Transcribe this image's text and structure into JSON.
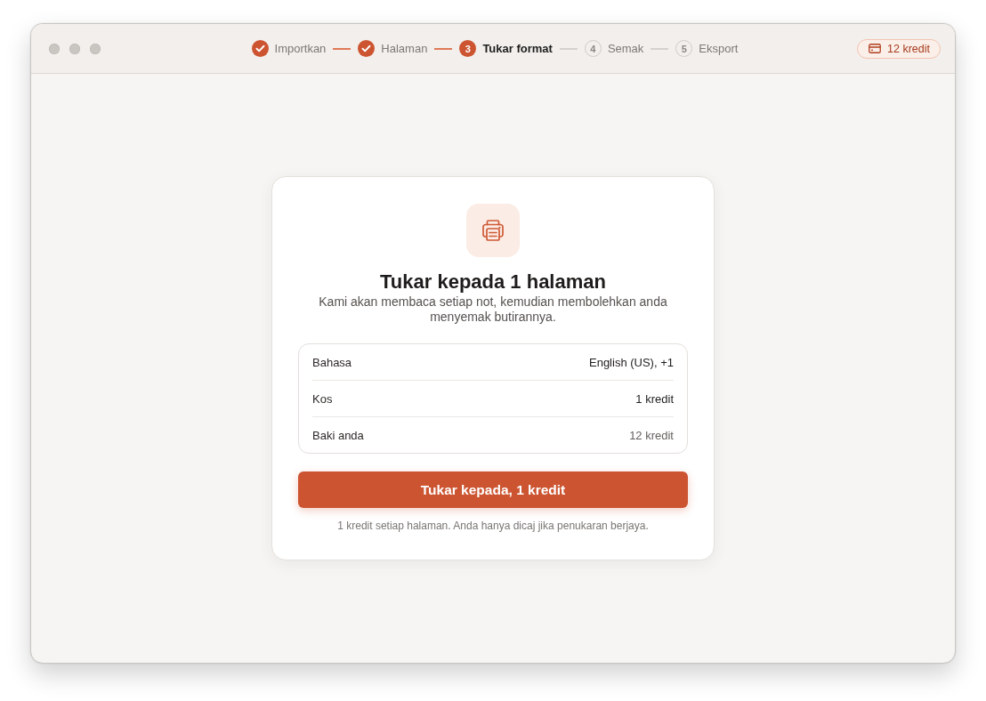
{
  "stepper": {
    "steps": [
      {
        "label": "Importkan",
        "done": true,
        "selected": false
      },
      {
        "label": "Halaman",
        "done": true,
        "selected": false
      },
      {
        "label": "Tukar format",
        "number": "3",
        "done": false,
        "selected": true
      },
      {
        "label": "Semak",
        "number": "4",
        "done": false,
        "selected": false
      },
      {
        "label": "Eksport",
        "number": "5",
        "done": false,
        "selected": false
      }
    ]
  },
  "credits_badge": {
    "label": "12 kredit"
  },
  "dialog": {
    "title": "Tukar kepada 1 halaman",
    "description": "Kami akan membaca setiap not, kemudian membolehkan anda menyemak butirannya.",
    "details": [
      {
        "label": "Bahasa",
        "value": "English (US), +1",
        "muted": false
      },
      {
        "label": "Kos",
        "value": "1 kredit",
        "muted": false
      },
      {
        "label": "Baki anda",
        "value": "12 kredit",
        "muted": true
      }
    ],
    "primary_button": {
      "label": "Tukar kepada, 1 kredit"
    },
    "footnote": "1 kredit setiap halaman. Anda hanya dicaj jika penukaran berjaya."
  }
}
